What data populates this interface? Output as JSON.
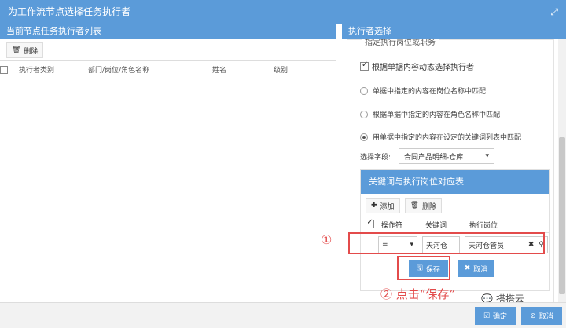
{
  "window": {
    "title": "为工作流节点选择任务执行者"
  },
  "left_panel": {
    "title": "当前节点任务执行者列表",
    "delete_label": "删除",
    "columns": [
      "执行者类别",
      "部门/岗位/角色名称",
      "姓名",
      "级别"
    ]
  },
  "right_panel": {
    "title": "执行者选择",
    "prev_option": "指定执行岗位或职务",
    "dynamic_option": "根据单据内容动态选择执行者",
    "radios": [
      {
        "label": "单据中指定的内容在岗位名称中匹配",
        "selected": false
      },
      {
        "label": "根据单据中指定的内容在角色名称中匹配",
        "selected": false
      },
      {
        "label": "用单据中指定的内容在设定的关键词列表中匹配",
        "selected": true
      }
    ],
    "field_label": "选择字段:",
    "field_value": "合同产品明细-仓库",
    "keyword_table": {
      "title": "关键词与执行岗位对应表",
      "add_label": "添加",
      "delete_label": "删除",
      "columns": [
        "操作符",
        "关键词",
        "执行岗位"
      ],
      "row": {
        "operator": "=",
        "keyword": "天河仓",
        "position": "天河仓管员"
      }
    },
    "save_label": "保存",
    "cancel_label": "取消"
  },
  "annotations": {
    "marker1": "①",
    "marker2": "② 点击“保存”"
  },
  "footer": {
    "confirm_label": "确定",
    "cancel_label": "取消"
  },
  "watermark": "搭搭云",
  "colors": {
    "primary": "#5b9bd9",
    "annotation": "#e34b4b"
  }
}
